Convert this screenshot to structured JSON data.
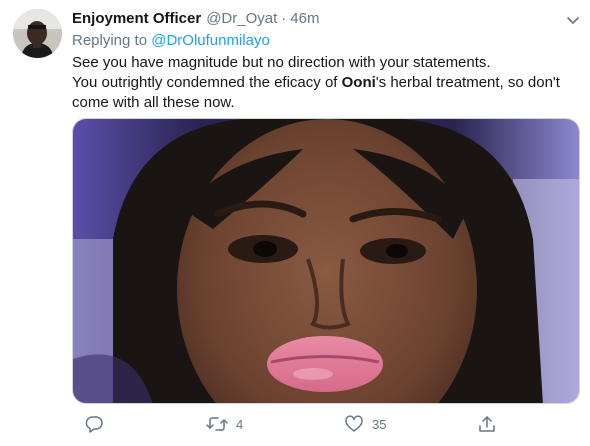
{
  "tweet": {
    "author_name": "Enjoyment Officer",
    "author_handle": "@Dr_Oyat",
    "separator": "·",
    "time": "46m",
    "replying_prefix": "Replying to",
    "replying_to": "@DrOlufunmilayo",
    "text_line1": "See you have magnitude but no direction with your statements.",
    "text_line2_a": "You outrightly condemned the eficacy of ",
    "text_line2_bold": "Ooni",
    "text_line2_b": "'s herbal treatment, so don't come with all these now.",
    "media_description_icon": "photo-icon"
  },
  "actions": {
    "reply_count": "",
    "retweet_count": "4",
    "like_count": "35"
  },
  "icons": {
    "caret": "chevron-down-icon",
    "reply": "reply-icon",
    "retweet": "retweet-icon",
    "like": "heart-icon",
    "share": "share-icon"
  },
  "colors": {
    "text": "#14171a",
    "secondary": "#657786",
    "link": "#1da1f2",
    "border": "#ccd6dd"
  }
}
